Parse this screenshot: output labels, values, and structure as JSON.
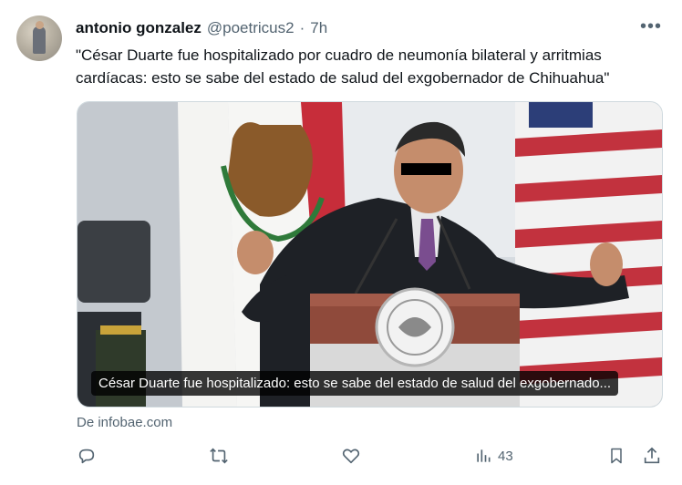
{
  "author": {
    "display_name": "antonio gonzalez",
    "handle": "@poetricus2",
    "separator": "·",
    "time": "7h"
  },
  "more_label": "•••",
  "tweet": {
    "text": "\"César Duarte fue hospitalizado por cuadro de neumonía bilateral y arritmias cardíacas: esto se sabe del estado de salud del exgobernador de Chihuahua\""
  },
  "card": {
    "caption": "César Duarte fue hospitalizado: esto se sabe del estado de salud del exgobernado...",
    "source": "De infobae.com"
  },
  "actions": {
    "views": "43"
  },
  "colors": {
    "text": "#0f1419",
    "secondary": "#536471",
    "border": "#cfd9de"
  }
}
